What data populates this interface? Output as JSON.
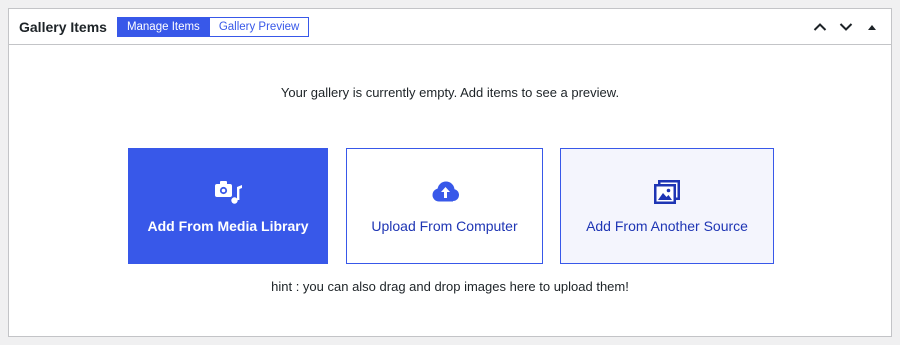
{
  "panel": {
    "title": "Gallery Items",
    "tabs": [
      {
        "label": "Manage Items",
        "active": true
      },
      {
        "label": "Gallery Preview",
        "active": false
      }
    ],
    "controls": {
      "move_up": "chevron-up-icon",
      "move_down": "chevron-down-icon",
      "toggle": "triangle-up-icon"
    }
  },
  "body": {
    "empty_message": "Your gallery is currently empty. Add items to see a preview.",
    "actions": [
      {
        "label": "Add From Media Library",
        "icon": "media-library-icon",
        "style": "primary"
      },
      {
        "label": "Upload From Computer",
        "icon": "cloud-upload-icon",
        "style": "secondary"
      },
      {
        "label": "Add From Another Source",
        "icon": "images-stack-icon",
        "style": "tertiary"
      }
    ],
    "hint": "hint : you can also drag and drop images here to upload them!"
  },
  "colors": {
    "accent": "#3858e9",
    "accent_text": "#1e35b4",
    "tertiary_bg": "#f4f5fd",
    "page_bg": "#f0f0f1",
    "border": "#c3c4c7"
  }
}
